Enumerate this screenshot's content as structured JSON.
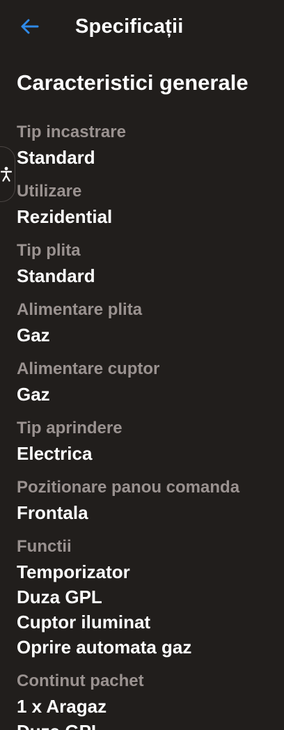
{
  "header": {
    "title": "Specificații",
    "back_icon": "arrow-left-icon",
    "accent_color": "#2f8ae8"
  },
  "section": {
    "title": "Caracteristici generale"
  },
  "accessibility": {
    "icon": "accessibility-person-icon"
  },
  "specs": [
    {
      "label": "Tip incastrare",
      "values": [
        "Standard"
      ]
    },
    {
      "label": "Utilizare",
      "values": [
        "Rezidential"
      ]
    },
    {
      "label": "Tip plita",
      "values": [
        "Standard"
      ]
    },
    {
      "label": "Alimentare plita",
      "values": [
        "Gaz"
      ]
    },
    {
      "label": "Alimentare cuptor",
      "values": [
        "Gaz"
      ]
    },
    {
      "label": "Tip aprindere",
      "values": [
        "Electrica"
      ]
    },
    {
      "label": "Pozitionare panou comanda",
      "values": [
        "Frontala"
      ]
    },
    {
      "label": "Functii",
      "values": [
        "Temporizator",
        "Duza GPL",
        "Cuptor iluminat",
        "Oprire automata gaz"
      ]
    },
    {
      "label": "Continut pachet",
      "values": [
        "1 x Aragaz",
        "Duza GPL"
      ]
    }
  ]
}
